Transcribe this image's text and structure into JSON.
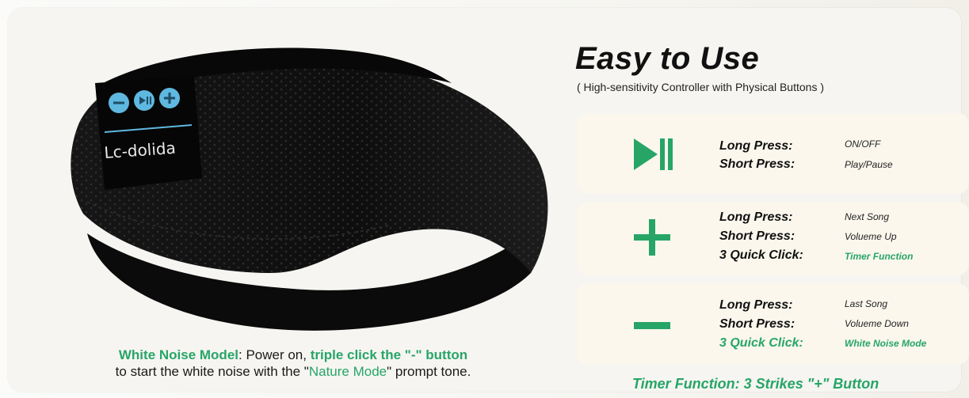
{
  "header": {
    "title": "Easy to Use",
    "subtitle": "( High-sensitivity Controller with Physical Buttons )"
  },
  "product": {
    "brand": "Lc-dolida"
  },
  "controls": [
    {
      "icon": "play-pause-icon",
      "rows": [
        {
          "label": "Long Press:",
          "value": "ON/OFF"
        },
        {
          "label": "Short Press:",
          "value": "Play/Pause"
        }
      ]
    },
    {
      "icon": "plus-icon",
      "rows": [
        {
          "label": "Long Press:",
          "value": "Next Song"
        },
        {
          "label": "Short Press:",
          "value": "Volueme Up"
        },
        {
          "label": "3 Quick Click:",
          "value": "Timer Function"
        }
      ]
    },
    {
      "icon": "minus-icon",
      "rows": [
        {
          "label": "Long Press:",
          "value": "Last Song"
        },
        {
          "label": "Short Press:",
          "value": "Volueme Down"
        },
        {
          "label": "3 Quick Click:",
          "value": "White Noise Mode"
        }
      ]
    }
  ],
  "caption": {
    "p1": "White Noise Model",
    "p2": ":  Power on, ",
    "p3": "triple click the \"-\" button",
    "p4": "to start the white noise with the \"",
    "p5": "Nature Mode",
    "p6": "\" prompt tone."
  },
  "footer": "Timer Function: 3 Strikes \"+\" Button",
  "colors": {
    "accent_green": "#27a567",
    "card_bg": "#fbf7ed",
    "button_blue": "#5fb8e0"
  }
}
